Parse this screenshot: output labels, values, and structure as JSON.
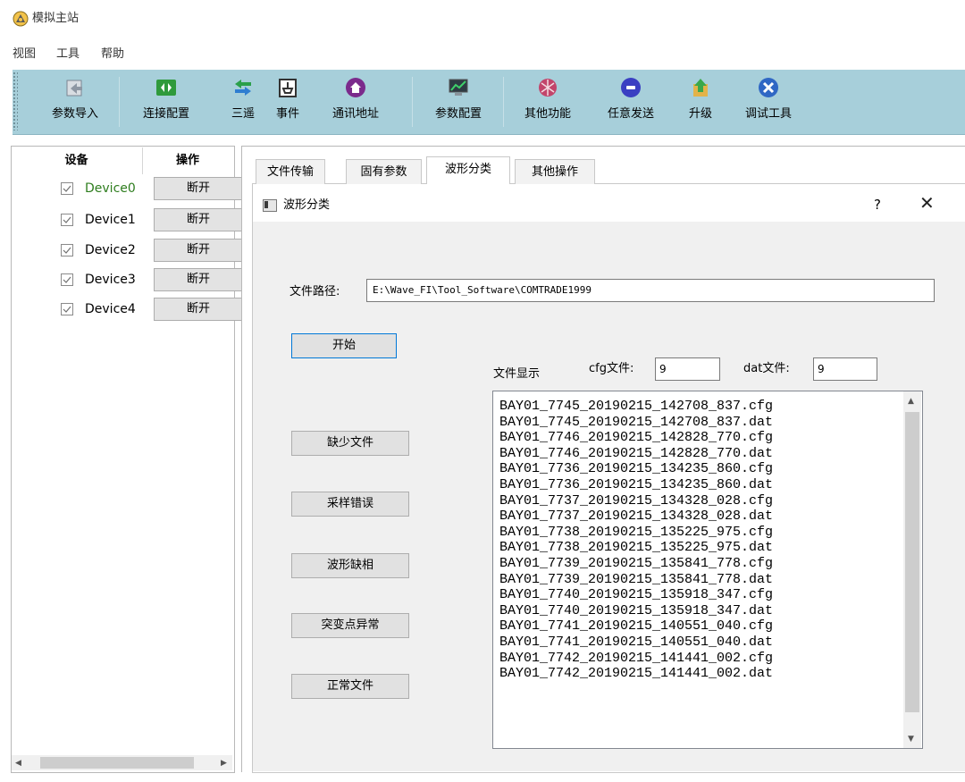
{
  "app": {
    "title": "模拟主站",
    "icon": "satellite-dish-icon"
  },
  "menu": [
    "视图",
    "工具",
    "帮助"
  ],
  "toolbar": [
    {
      "label": "参数导入",
      "icon": "import-icon"
    },
    {
      "label": "连接配置",
      "icon": "connect-icon"
    },
    {
      "label": "三遥",
      "icon": "arrows-exchange-icon"
    },
    {
      "label": "事件",
      "icon": "event-icon"
    },
    {
      "label": "通讯地址",
      "icon": "home-icon"
    },
    {
      "label": "参数配置",
      "icon": "monitor-config-icon"
    },
    {
      "label": "其他功能",
      "icon": "shield-icon"
    },
    {
      "label": "任意发送",
      "icon": "send-icon"
    },
    {
      "label": "升级",
      "icon": "upgrade-icon"
    },
    {
      "label": "调试工具",
      "icon": "tools-icon"
    }
  ],
  "device_table": {
    "headers": [
      "设备",
      "操作"
    ],
    "rows": [
      {
        "name": "Device0",
        "action": "断开",
        "checked": true,
        "highlight_color": "#2e7d1e"
      },
      {
        "name": "Device1",
        "action": "断开",
        "checked": true
      },
      {
        "name": "Device2",
        "action": "断开",
        "checked": true
      },
      {
        "name": "Device3",
        "action": "断开",
        "checked": true
      },
      {
        "name": "Device4",
        "action": "断开",
        "checked": true
      }
    ]
  },
  "tabs": [
    {
      "label": "文件传输",
      "active": false
    },
    {
      "label": "固有参数",
      "active": false
    },
    {
      "label": "波形分类",
      "active": true
    },
    {
      "label": "其他操作",
      "active": false
    }
  ],
  "dialog": {
    "title": "波形分类",
    "help": "?",
    "close": "✕",
    "path_label": "文件路径:",
    "path_value": "E:\\Wave_FI\\Tool_Software\\COMTRADE1999",
    "start_button": "开始",
    "side_buttons": [
      "缺少文件",
      "采样错误",
      "波形缺相",
      "突变点异常",
      "正常文件"
    ],
    "file_display_label": "文件显示",
    "cfg_label": "cfg文件:",
    "cfg_value": "9",
    "dat_label": "dat文件:",
    "dat_value": "9",
    "files": [
      "BAY01_7745_20190215_142708_837.cfg",
      "BAY01_7745_20190215_142708_837.dat",
      "BAY01_7746_20190215_142828_770.cfg",
      "BAY01_7746_20190215_142828_770.dat",
      "BAY01_7736_20190215_134235_860.cfg",
      "BAY01_7736_20190215_134235_860.dat",
      "BAY01_7737_20190215_134328_028.cfg",
      "BAY01_7737_20190215_134328_028.dat",
      "BAY01_7738_20190215_135225_975.cfg",
      "BAY01_7738_20190215_135225_975.dat",
      "BAY01_7739_20190215_135841_778.cfg",
      "BAY01_7739_20190215_135841_778.dat",
      "BAY01_7740_20190215_135918_347.cfg",
      "BAY01_7740_20190215_135918_347.dat",
      "BAY01_7741_20190215_140551_040.cfg",
      "BAY01_7741_20190215_140551_040.dat",
      "BAY01_7742_20190215_141441_002.cfg",
      "BAY01_7742_20190215_141441_002.dat"
    ]
  },
  "colors": {
    "toolbar_bg": "#a7cfda",
    "device_active": "#2e7d1e",
    "focus_border": "#0078d7"
  }
}
